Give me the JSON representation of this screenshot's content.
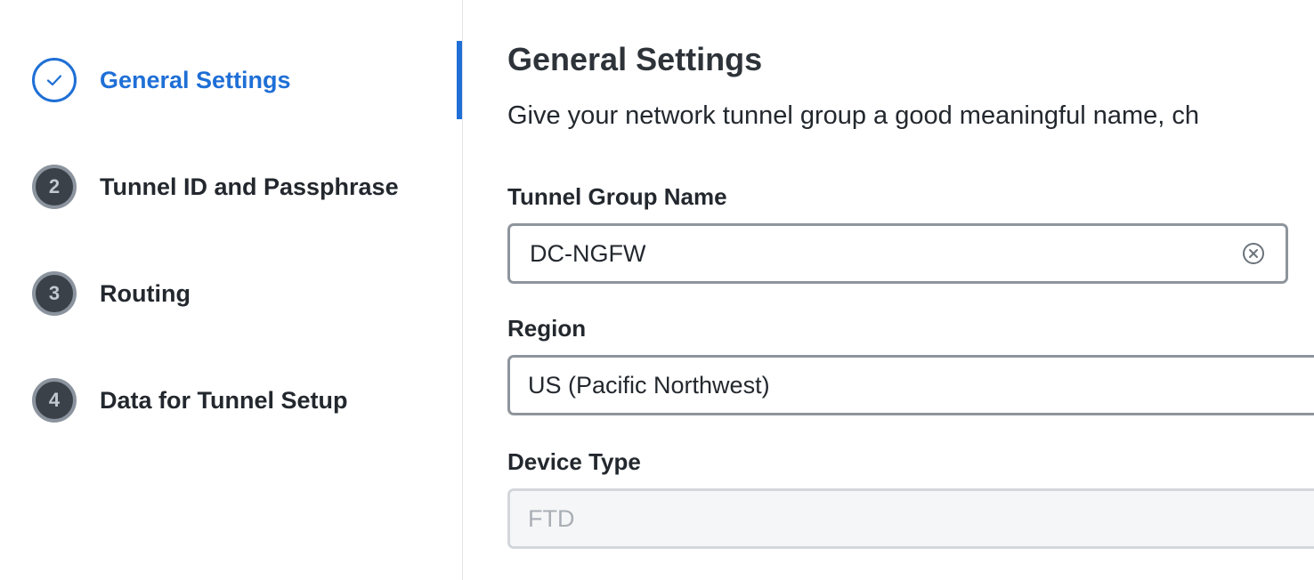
{
  "stepper": {
    "steps": [
      {
        "number": "",
        "label": "General Settings",
        "state": "complete-active"
      },
      {
        "number": "2",
        "label": "Tunnel ID and Passphrase",
        "state": "pending"
      },
      {
        "number": "3",
        "label": "Routing",
        "state": "pending"
      },
      {
        "number": "4",
        "label": "Data for Tunnel Setup",
        "state": "pending"
      }
    ]
  },
  "main": {
    "title": "General Settings",
    "description": "Give your network tunnel group a good meaningful name, ch",
    "fields": {
      "tunnel_group_name": {
        "label": "Tunnel Group Name",
        "value": "DC-NGFW"
      },
      "region": {
        "label": "Region",
        "value": "US (Pacific Northwest)"
      },
      "device_type": {
        "label": "Device Type",
        "value": "FTD",
        "disabled": true
      }
    }
  },
  "icons": {
    "step_complete": "checkmark-icon",
    "clear_input": "clear-circle-x-icon"
  },
  "colors": {
    "accent": "#1f6fd6",
    "pending_badge": "#3a4149",
    "input_border": "#8e959c",
    "disabled_bg": "#f5f6f7"
  }
}
